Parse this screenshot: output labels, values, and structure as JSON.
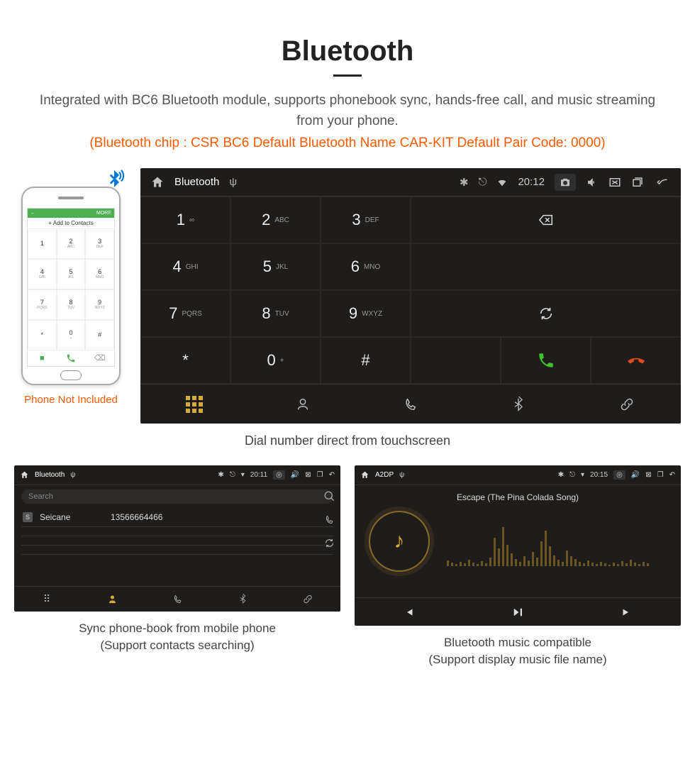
{
  "page": {
    "title": "Bluetooth",
    "description": "Integrated with BC6 Bluetooth module, supports phonebook sync, hands-free call, and music streaming from your phone.",
    "spec_line": "(Bluetooth chip : CSR BC6    Default Bluetooth Name CAR-KIT    Default Pair Code: 0000)"
  },
  "phone": {
    "header_left": "←",
    "header_right": "MORE",
    "contacts_label": "Add to Contacts",
    "caption": "Phone Not Included",
    "keys": [
      {
        "num": "1",
        "sub": ""
      },
      {
        "num": "2",
        "sub": "ABC"
      },
      {
        "num": "3",
        "sub": "DEF"
      },
      {
        "num": "4",
        "sub": "GHI"
      },
      {
        "num": "5",
        "sub": "JKL"
      },
      {
        "num": "6",
        "sub": "MNO"
      },
      {
        "num": "7",
        "sub": "PQRS"
      },
      {
        "num": "8",
        "sub": "TUV"
      },
      {
        "num": "9",
        "sub": "WXYZ"
      },
      {
        "num": "*",
        "sub": ""
      },
      {
        "num": "0",
        "sub": "+"
      },
      {
        "num": "#",
        "sub": ""
      }
    ]
  },
  "dialer": {
    "status": {
      "title": "Bluetooth",
      "time": "20:12"
    },
    "keys": [
      {
        "num": "1",
        "sub": "∞"
      },
      {
        "num": "2",
        "sub": "ABC"
      },
      {
        "num": "3",
        "sub": "DEF"
      },
      {
        "num": "4",
        "sub": "GHI"
      },
      {
        "num": "5",
        "sub": "JKL"
      },
      {
        "num": "6",
        "sub": "MNO"
      },
      {
        "num": "7",
        "sub": "PQRS"
      },
      {
        "num": "8",
        "sub": "TUV"
      },
      {
        "num": "9",
        "sub": "WXYZ"
      },
      {
        "num": "*",
        "sub": ""
      },
      {
        "num": "0",
        "sub": "+"
      },
      {
        "num": "#",
        "sub": ""
      }
    ],
    "caption": "Dial number direct from touchscreen"
  },
  "contacts": {
    "status": {
      "title": "Bluetooth",
      "time": "20:11"
    },
    "search_placeholder": "Search",
    "entry": {
      "badge": "S",
      "name": "Seicane",
      "number": "13566664466"
    },
    "caption_line1": "Sync phone-book from mobile phone",
    "caption_line2": "(Support contacts searching)"
  },
  "music": {
    "status": {
      "title": "A2DP",
      "time": "20:15"
    },
    "track": "Escape (The Pina Colada Song)",
    "caption_line1": "Bluetooth music compatible",
    "caption_line2": "(Support display music file name)"
  }
}
